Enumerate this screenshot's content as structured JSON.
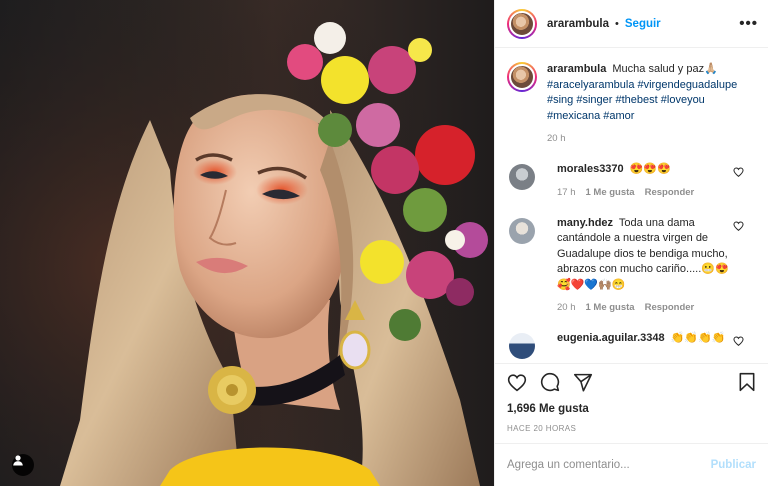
{
  "post": {
    "author": "ararambula",
    "follow_label": "Seguir",
    "dot": "•",
    "more_label": "•••",
    "caption": {
      "user": "ararambula",
      "text": "Mucha salud y paz🙏🏼",
      "hashtags": [
        "#aracelyarambula",
        "#virgendeguadalupe",
        "#sing",
        "#singer",
        "#thebest",
        "#loveyou",
        "#mexicana",
        "#amor"
      ],
      "time": "20 h"
    },
    "comments": [
      {
        "user": "morales3370",
        "text": "😍😍😍",
        "time": "17 h",
        "likes": "1 Me gusta",
        "reply": "Responder",
        "avatar_color": "#7a7f86"
      },
      {
        "user": "many.hdez",
        "text": "Toda una dama cantándole a nuestra virgen de Guadalupe dios te bendiga mucho, abrazos con mucho cariño.....😬😍🥰❤️💙🙌🏽😁",
        "time": "20 h",
        "likes": "1 Me gusta",
        "reply": "Responder",
        "avatar_color": "#9aa3ad"
      },
      {
        "user": "eugenia.aguilar.3348",
        "text": "👏👏👏👏",
        "avatar_color": "#2f4d7a"
      }
    ],
    "likes": "1,696 Me gusta",
    "posted_ago": "HACE 20 HORAS",
    "comment_placeholder": "Agrega un comentario...",
    "publish_label": "Publicar"
  },
  "icons": [
    "heart-icon",
    "comment-icon",
    "share-icon",
    "bookmark-icon",
    "user-tag-icon",
    "more-icon"
  ],
  "colors": {
    "link": "#0095f6",
    "hashtag": "#00376b",
    "muted": "#8e8e8e",
    "publish_disabled": "#b2dffc"
  }
}
